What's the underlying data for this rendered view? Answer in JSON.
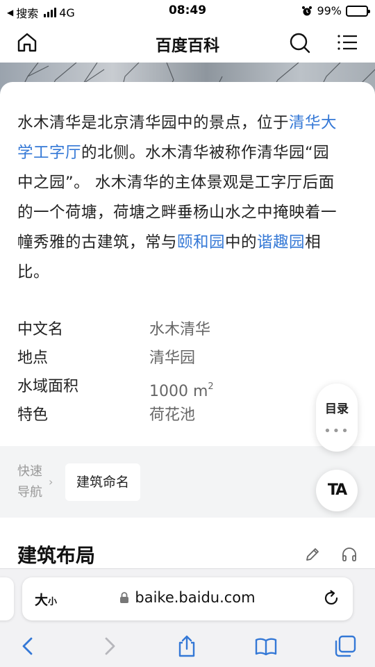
{
  "status_bar": {
    "back_app": "搜索",
    "network": "4G",
    "time": "08:49",
    "battery": "99%",
    "battery_level": 0.99,
    "signal_bars": 4
  },
  "header": {
    "title": "百度百科",
    "home_icon": "home-icon",
    "search_icon": "search-icon",
    "menu_icon": "menu-list-icon"
  },
  "summary": {
    "t1": "水木清华是北京清华园中的景点，位于",
    "link1": "清华大学工字厅",
    "t2": "的北侧。水木清华被称作清华园“园中之园”。 水木清华的主体景观是工字厅后面的一个荷塘，荷塘之畔垂杨山水之中掩映着一幢秀雅的古建筑，常与",
    "link2": "颐和园",
    "t3": "中的",
    "link3": "谐趣园",
    "t4": "相比。"
  },
  "infobox": {
    "rows": [
      {
        "label": "中文名",
        "value": "水木清华"
      },
      {
        "label": "地点",
        "value": "清华园"
      },
      {
        "label": "水域面积",
        "value": "1000 m",
        "sup": "2"
      },
      {
        "label": "特色",
        "value": "荷花池"
      }
    ]
  },
  "quick_nav": {
    "label_line1": "快速",
    "label_line2": "导航",
    "chip": "建筑命名"
  },
  "floating": {
    "toc_label": "目录",
    "toc_more": "•••",
    "ta_label": "TA"
  },
  "section": {
    "title": "建筑布局",
    "edit_icon": "pencil-icon",
    "listen_icon": "headphones-icon"
  },
  "safari": {
    "text_size_big": "大",
    "text_size_small": "小",
    "url": "baike.baidu.com",
    "colors": {
      "accent": "#3478d6"
    }
  }
}
